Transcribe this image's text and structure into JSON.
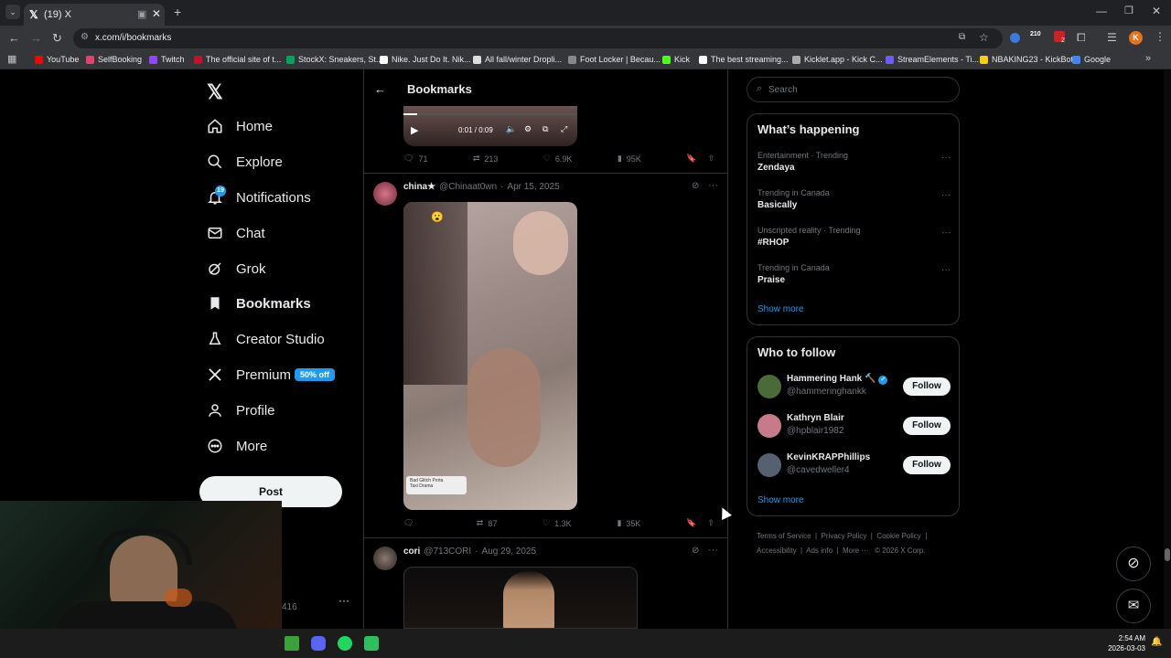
{
  "browser": {
    "tab_title": "(19) X",
    "url": "x.com/i/bookmarks",
    "bookmarks": [
      {
        "label": "YouTube",
        "color": "#ff0000"
      },
      {
        "label": "SelfBooking",
        "color": "#e0436b"
      },
      {
        "label": "Twitch",
        "color": "#9146ff"
      },
      {
        "label": "The official site of t...",
        "color": "#c8102e"
      },
      {
        "label": "StockX: Sneakers, St...",
        "color": "#08a05c"
      },
      {
        "label": "Nike. Just Do It. Nik...",
        "color": "#ffffff"
      },
      {
        "label": "All fall/winter Dropli...",
        "color": "#dddddd"
      },
      {
        "label": "Foot Locker | Becau...",
        "color": "#888888"
      },
      {
        "label": "Kick",
        "color": "#53fc18"
      },
      {
        "label": "The best streaming...",
        "color": "#ffffff"
      },
      {
        "label": "Kicklet.app - Kick C...",
        "color": "#aaaaaa"
      },
      {
        "label": "StreamElements - Ti...",
        "color": "#6a5cff"
      },
      {
        "label": "NBAKING23 - KickBot",
        "color": "#f7d000"
      },
      {
        "label": "Google",
        "color": "#4285f4"
      }
    ],
    "ext_badge": "210",
    "ext_badge2": "2",
    "profile_initial": "K"
  },
  "sidebar": {
    "items": [
      {
        "label": "Home",
        "icon": "home-icon"
      },
      {
        "label": "Explore",
        "icon": "search-icon"
      },
      {
        "label": "Notifications",
        "icon": "bell-icon",
        "badge": "19"
      },
      {
        "label": "Chat",
        "icon": "mail-icon"
      },
      {
        "label": "Grok",
        "icon": "grok-icon"
      },
      {
        "label": "Bookmarks",
        "icon": "bookmark-icon"
      },
      {
        "label": "Creator Studio",
        "icon": "flask-icon"
      },
      {
        "label": "Premium",
        "icon": "x-icon"
      },
      {
        "label": "Profile",
        "icon": "person-icon"
      },
      {
        "label": "More",
        "icon": "more-circle-icon"
      }
    ],
    "premium_badge": "50% off",
    "post_label": "Post",
    "account_partial": "416"
  },
  "header": {
    "title": "Bookmarks"
  },
  "video": {
    "time": "0:01 / 0:09"
  },
  "tweet1_stats": {
    "replies": "71",
    "reposts": "213",
    "likes": "6.9K",
    "views": "95K"
  },
  "tweet2": {
    "name": "china★",
    "handle": "@Chinaat0wn",
    "date": "Apr 15, 2025",
    "image_label": "Bad Glitch Porta\nTaxi Drama",
    "stats": {
      "replies": "",
      "reposts": "87",
      "likes": "1.3K",
      "views": "35K"
    }
  },
  "tweet3": {
    "name": "cori",
    "handle": "@713CORI",
    "date": "Aug 29, 2025"
  },
  "search": {
    "placeholder": "Search"
  },
  "trends": {
    "title": "What’s happening",
    "items": [
      {
        "category": "Entertainment · Trending",
        "name": "Zendaya"
      },
      {
        "category": "Trending in Canada",
        "name": "Basically"
      },
      {
        "category": "Unscripted reality · Trending",
        "name": "#RHOP"
      },
      {
        "category": "Trending in Canada",
        "name": "Praise"
      }
    ],
    "show_more": "Show more"
  },
  "who_to_follow": {
    "title": "Who to follow",
    "items": [
      {
        "name": "Hammering Hank 🔨",
        "handle": "@hammeringhankk",
        "verified": true,
        "avatar": "#4a6a3a"
      },
      {
        "name": "Kathryn Blair",
        "handle": "@hpblair1982",
        "verified": false,
        "avatar": "#c77b8a"
      },
      {
        "name": "KevinKRAPPhillips",
        "handle": "@cavedweller4",
        "verified": false,
        "avatar": "#556070"
      }
    ],
    "follow_label": "Follow",
    "show_more": "Show more"
  },
  "footer": {
    "links": [
      "Terms of Service",
      "Privacy Policy",
      "Cookie Policy",
      "Accessibility",
      "Ads info",
      "More ···"
    ],
    "copyright": "© 2026 X Corp."
  },
  "taskbar": {
    "time": "2:54 AM",
    "date": "2026-03-03"
  }
}
